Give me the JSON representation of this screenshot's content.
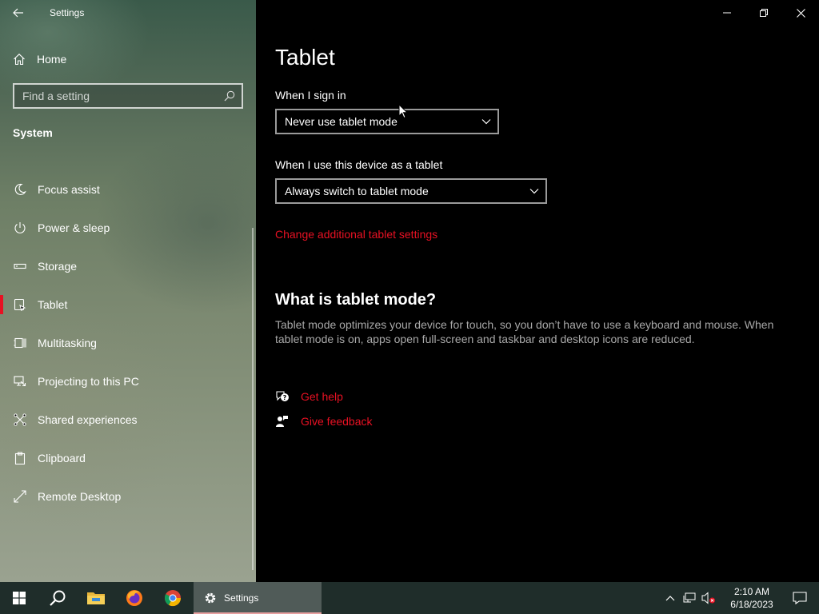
{
  "window": {
    "app_title": "Settings"
  },
  "sidebar": {
    "home_label": "Home",
    "search_placeholder": "Find a setting",
    "section_title": "System",
    "items": [
      {
        "label": "Focus assist",
        "icon": "moon-icon"
      },
      {
        "label": "Power & sleep",
        "icon": "power-icon"
      },
      {
        "label": "Storage",
        "icon": "storage-icon"
      },
      {
        "label": "Tablet",
        "icon": "tablet-icon",
        "selected": true
      },
      {
        "label": "Multitasking",
        "icon": "multitasking-icon"
      },
      {
        "label": "Projecting to this PC",
        "icon": "projecting-icon"
      },
      {
        "label": "Shared experiences",
        "icon": "shared-experiences-icon"
      },
      {
        "label": "Clipboard",
        "icon": "clipboard-icon"
      },
      {
        "label": "Remote Desktop",
        "icon": "remote-desktop-icon"
      }
    ]
  },
  "main": {
    "title": "Tablet",
    "sign_in_label": "When I sign in",
    "sign_in_value": "Never use tablet mode",
    "device_label": "When I use this device as a tablet",
    "device_value": "Always switch to tablet mode",
    "additional_link": "Change additional tablet settings",
    "what_is_heading": "What is tablet mode?",
    "what_is_desc": "Tablet mode optimizes your device for touch, so you don’t have to use a keyboard and mouse. When tablet mode is on, apps open full-screen and taskbar and desktop icons are reduced.",
    "get_help": "Get help",
    "give_feedback": "Give feedback"
  },
  "taskbar": {
    "settings_label": "Settings",
    "time": "2:10 AM",
    "date": "6/18/2023"
  },
  "colors": {
    "accent": "#e81123",
    "taskbar": "#1f2d2a"
  }
}
